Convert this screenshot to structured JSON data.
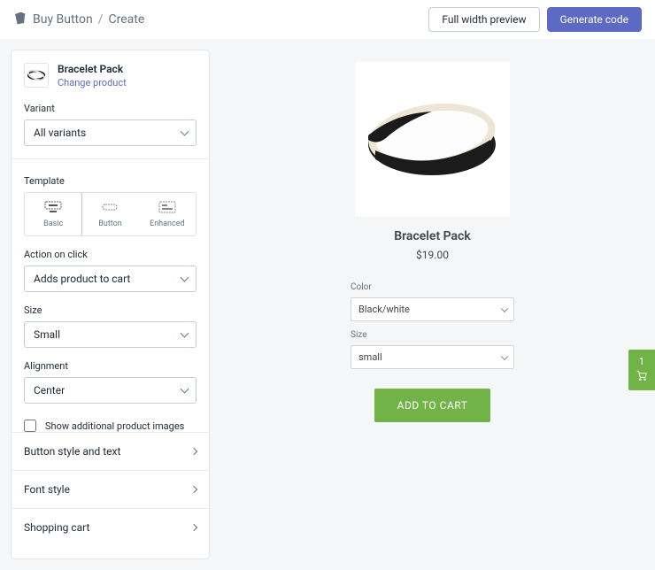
{
  "breadcrumb": {
    "parent": "Buy Button",
    "sep": "/",
    "current": "Create"
  },
  "actions": {
    "preview": "Full width preview",
    "generate": "Generate code"
  },
  "product": {
    "name": "Bracelet Pack",
    "change": "Change product"
  },
  "variant": {
    "label": "Variant",
    "value": "All variants"
  },
  "template": {
    "label": "Template",
    "items": [
      {
        "key": "basic",
        "label": "Basic",
        "selected": true
      },
      {
        "key": "button",
        "label": "Button",
        "selected": false
      },
      {
        "key": "enhanced",
        "label": "Enhanced",
        "selected": false
      }
    ]
  },
  "action_on_click": {
    "label": "Action on click",
    "value": "Adds product to cart"
  },
  "size": {
    "label": "Size",
    "value": "Small"
  },
  "alignment": {
    "label": "Alignment",
    "value": "Center"
  },
  "checkbox": {
    "label": "Show additional product images",
    "checked": false
  },
  "accordion": [
    {
      "key": "button-style",
      "label": "Button style and text"
    },
    {
      "key": "font-style",
      "label": "Font style"
    },
    {
      "key": "shopping-cart",
      "label": "Shopping cart"
    }
  ],
  "preview": {
    "title": "Bracelet Pack",
    "price": "$19.00",
    "color": {
      "label": "Color",
      "value": "Black/white"
    },
    "size": {
      "label": "Size",
      "value": "small"
    },
    "button": "ADD TO CART"
  },
  "cart": {
    "count": "1"
  }
}
